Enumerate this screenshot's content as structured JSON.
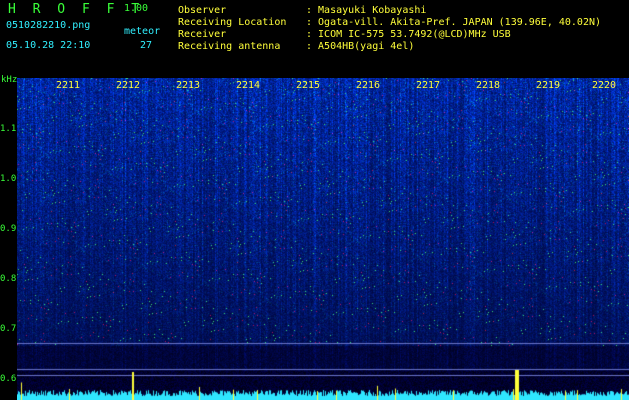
{
  "header": {
    "logo": "H R O F F T",
    "version": "1.00",
    "filename": "0510282210.png",
    "meteor_label": "meteor",
    "datetime": "05.10.28 22:10",
    "meteor_count": "27"
  },
  "info": [
    {
      "label": "Observer",
      "value": ": Masayuki Kobayashi"
    },
    {
      "label": "Receiving Location",
      "value": ": Ogata-vill. Akita-Pref. JAPAN (139.96E, 40.02N)"
    },
    {
      "label": "Receiver",
      "value": ": ICOM IC-575 53.7492(@LCD)MHz USB"
    },
    {
      "label": "Receiving antenna",
      "value": ": A504HB(yagi 4el)"
    }
  ],
  "y_axis": {
    "unit": "kHz",
    "ticks": [
      "1.1",
      "1.0",
      "0.9",
      "0.8",
      "0.7",
      "0.6"
    ]
  },
  "x_axis": {
    "ticks": [
      "2211",
      "2212",
      "2213",
      "2214",
      "2215",
      "2216",
      "2217",
      "2218",
      "2219",
      "2220"
    ]
  },
  "colors": {
    "label_green": "#39ff39",
    "label_cyan": "#31f0ff",
    "label_yellow": "#ffff3a",
    "background": "#000000"
  }
}
